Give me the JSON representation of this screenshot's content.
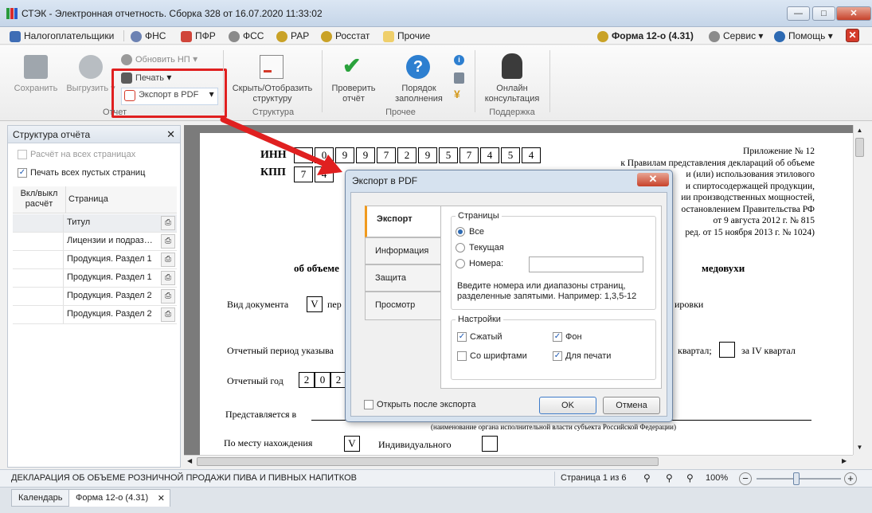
{
  "app": {
    "title": "СТЭК - Электронная отчетность. Сборка 328 от 16.07.2020 11:33:02"
  },
  "menu": {
    "items": [
      "Налогоплательщики",
      "ФНС",
      "ПФР",
      "ФСС",
      "РАР",
      "Росстат",
      "Прочие"
    ],
    "right": {
      "form": "Форма 12-о (4.31)",
      "service": "Сервис",
      "help": "Помощь"
    }
  },
  "ribbon": {
    "save": "Сохранить",
    "upload": "Выгрузить",
    "update_np": "Обновить НП",
    "print": "Печать",
    "export_pdf": "Экспорт в PDF",
    "group_report": "Отчет",
    "toggle_structure": "Скрыть/Отобразить структуру",
    "group_structure": "Структура",
    "check_report": "Проверить отчёт",
    "fill_order": "Порядок заполнения",
    "group_other": "Прочее",
    "online": "Онлайн консультация",
    "group_support": "Поддержка"
  },
  "panel": {
    "title": "Структура отчёта",
    "calc_all": "Расчёт на всех страницах",
    "print_empty": "Печать всех пустых страниц",
    "col_toggle": "Вкл/выкл расчёт",
    "col_page": "Страница",
    "rows": [
      "Титул",
      "Лицензии и подраз…",
      "Продукция. Раздел 1",
      "Продукция. Раздел 1",
      "Продукция. Раздел 2",
      "Продукция. Раздел 2"
    ]
  },
  "document": {
    "inn_label": "ИНН",
    "inn": [
      "",
      "0",
      "9",
      "9",
      "7",
      "2",
      "9",
      "5",
      "7",
      "4",
      "5",
      "4"
    ],
    "kpp_label": "КПП",
    "kpp": [
      "7",
      "4"
    ],
    "appendix_lines": [
      "Приложение № 12",
      "к Правилам представления деклараций об объеме",
      "и (или) использования этилового",
      "и спиртосодержащей продукции,",
      "ии производственных мощностей,",
      "остановлением Правительства РФ",
      "от 9 августа 2012 г. № 815",
      "ред. от 15 ноября 2013 г. № 1024)"
    ],
    "heading_left": "об объеме",
    "heading_right": "медовухи",
    "doc_type_label": "Вид документа",
    "doc_type_value": "V",
    "doc_type_tail": "пер",
    "right_tail": "ировки",
    "period_label": "Отчетный период указыва",
    "period_right": "квартал;",
    "period_q4": "за IV квартал",
    "year_label": "Отчетный год",
    "year": [
      "2",
      "0",
      "2"
    ],
    "presented_label": "Представляется в",
    "presented_sub": "(наименование органа исполнительной власти субъекта Российской Федерации)",
    "location_label": "По месту нахождения",
    "location_value": "V",
    "individual_label": "Индивидуального"
  },
  "dialog": {
    "title": "Экспорт в PDF",
    "tabs": [
      "Экспорт",
      "Информация",
      "Защита",
      "Просмотр"
    ],
    "pages_group": "Страницы",
    "opt_all": "Все",
    "opt_current": "Текущая",
    "opt_numbers": "Номера:",
    "numbers_value": "",
    "hint": "Введите номера или диапазоны страниц, разделенные запятыми. Например: 1,3,5-12",
    "settings_group": "Настройки",
    "compressed": "Сжатый",
    "background": "Фон",
    "with_fonts": "Со шрифтами",
    "for_print": "Для печати",
    "open_after": "Открыть после экспорта",
    "ok": "OK",
    "cancel": "Отмена"
  },
  "status": {
    "text": "ДЕКЛАРАЦИЯ ОБ ОБЪЕМЕ РОЗНИЧНОЙ ПРОДАЖИ ПИВА И ПИВНЫХ НАПИТКОВ",
    "page": "Страница 1 из 6",
    "zoom": "100%"
  },
  "tabs": {
    "calendar": "Календарь",
    "form": "Форма 12-о (4.31)"
  },
  "colors": {
    "accent": "#2d6ab3",
    "highlight": "#e02020"
  }
}
